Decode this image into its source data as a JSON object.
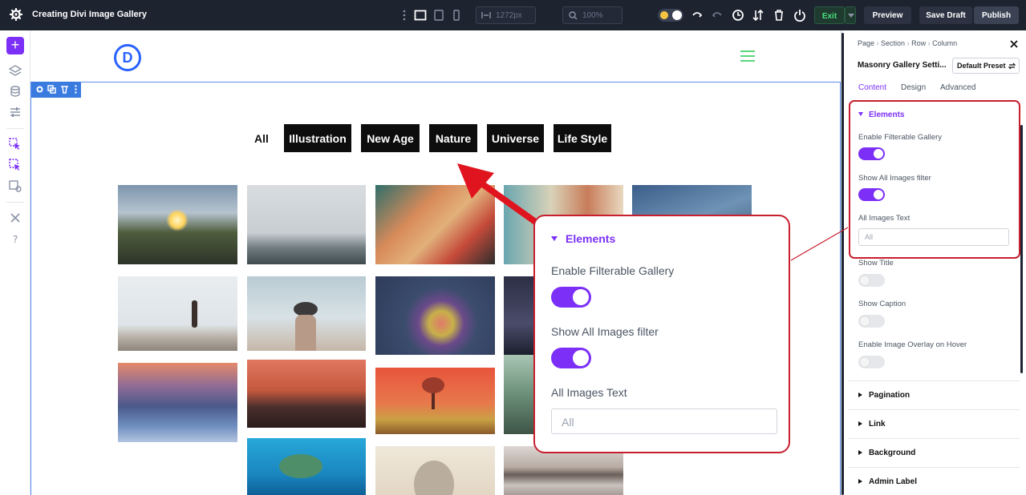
{
  "topbar": {
    "title": "Creating Divi Image Gallery",
    "width_value": "1272px",
    "zoom_value": "100%",
    "exit_label": "Exit",
    "preview_label": "Preview",
    "save_label": "Save Draft",
    "publish_label": "Publish"
  },
  "canvas": {
    "logo_letter": "D",
    "filters": [
      "All",
      "Illustration",
      "New Age",
      "Nature",
      "Universe",
      "Life Style"
    ],
    "active_filter": "All"
  },
  "callout": {
    "heading": "Elements",
    "enable_filterable_label": "Enable Filterable Gallery",
    "show_all_label": "Show All Images filter",
    "all_images_text_label": "All Images Text",
    "all_images_text_placeholder": "All"
  },
  "panel": {
    "breadcrumb": [
      "Page",
      "Section",
      "Row",
      "Column"
    ],
    "title": "Masonry Gallery Setti...",
    "preset_label": "Default Preset",
    "tabs": [
      "Content",
      "Design",
      "Advanced"
    ],
    "active_tab": "Content",
    "elements": {
      "heading": "Elements",
      "enable_filterable_label": "Enable Filterable Gallery",
      "enable_filterable_on": true,
      "show_all_label": "Show All Images filter",
      "show_all_on": true,
      "all_images_text_label": "All Images Text",
      "all_images_text_placeholder": "All",
      "show_title_label": "Show Title",
      "show_title_on": false,
      "show_caption_label": "Show Caption",
      "show_caption_on": false,
      "overlay_label": "Enable Image Overlay on Hover",
      "overlay_on": false
    },
    "groups": [
      "Pagination",
      "Link",
      "Background",
      "Admin Label"
    ]
  },
  "colors": {
    "accent": "#7b2ff7",
    "callout_border": "#c81e2e",
    "topbar_bg": "#1e2330",
    "logo_blue": "#2962ff",
    "hamburger_green": "#5bd57e"
  }
}
